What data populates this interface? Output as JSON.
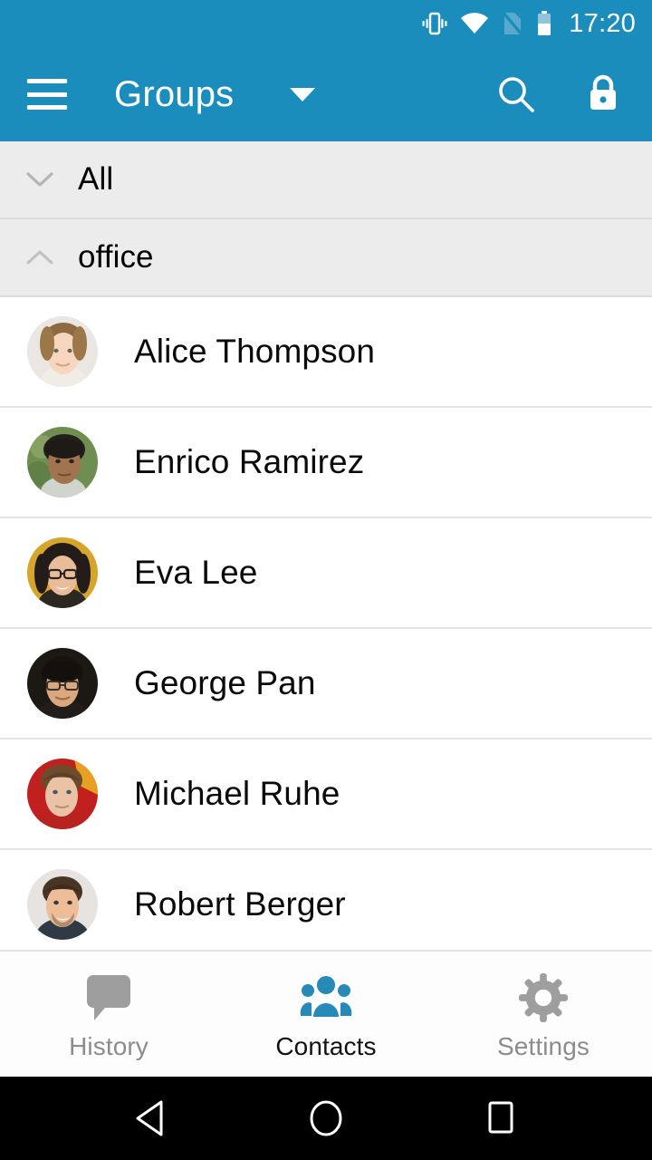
{
  "status_bar": {
    "time": "17:20",
    "icons": [
      {
        "name": "vibrate-icon",
        "label": "vibrate"
      },
      {
        "name": "wifi-icon",
        "label": "wifi"
      },
      {
        "name": "no-sim-icon",
        "label": "no-sim"
      },
      {
        "name": "battery-icon",
        "label": "battery"
      }
    ],
    "background_color": "#1b8dbd",
    "foreground_color": "#ffffff"
  },
  "app_bar": {
    "menu_icon": "hamburger-menu-icon",
    "title": "Groups",
    "dropdown_icon": "chevron-down-icon",
    "actions": [
      {
        "name": "search-icon",
        "label": "Search"
      },
      {
        "name": "lock-icon",
        "label": "Lock"
      }
    ],
    "background_color": "#1b8dbd"
  },
  "groups": [
    {
      "label": "All",
      "expanded": false,
      "chevron": "chevron-down-icon"
    },
    {
      "label": "office",
      "expanded": true,
      "chevron": "chevron-up-icon"
    }
  ],
  "contacts": [
    {
      "name": "Alice Thompson",
      "avatar": {
        "name": "avatar-alice-thompson",
        "bg": "#e6e4e2",
        "skin": "#f3d4be",
        "hair": "#9c7446",
        "cloth": "#f0eae6"
      }
    },
    {
      "name": "Enrico Ramirez",
      "avatar": {
        "name": "avatar-enrico-ramirez",
        "bg": "#6f8f52",
        "skin": "#9e7050",
        "hair": "#23201c",
        "cloth": "#cfd4cc"
      }
    },
    {
      "name": "Eva Lee",
      "avatar": {
        "name": "avatar-eva-lee",
        "bg": "#d6a62c",
        "skin": "#e6b894",
        "hair": "#241c18",
        "cloth": "#2d2722"
      }
    },
    {
      "name": "George Pan",
      "avatar": {
        "name": "avatar-george-pan",
        "bg": "#1c1814",
        "skin": "#d6a47a",
        "hair": "#171310",
        "cloth": "#201b17"
      }
    },
    {
      "name": "Michael Ruhe",
      "avatar": {
        "name": "avatar-michael-ruhe",
        "bg": "#c0201e",
        "skin": "#e8c0a4",
        "hair": "#6d4b2c",
        "cloth": "#b8221f"
      }
    },
    {
      "name": "Robert Berger",
      "avatar": {
        "name": "avatar-robert-berger",
        "bg": "#e3e1de",
        "skin": "#e8bb96",
        "hair": "#4a3525",
        "cloth": "#2f3a46"
      }
    }
  ],
  "tab_bar": {
    "active_color": "#2789b8",
    "inactive_color": "#9a9a9a",
    "items": [
      {
        "label": "History",
        "icon": "speech-bubble-icon",
        "active": false
      },
      {
        "label": "Contacts",
        "icon": "people-group-icon",
        "active": true
      },
      {
        "label": "Settings",
        "icon": "gear-icon",
        "active": false
      }
    ]
  },
  "nav_bar": {
    "buttons": [
      {
        "name": "back-triangle-icon",
        "label": "Back"
      },
      {
        "name": "home-circle-icon",
        "label": "Home"
      },
      {
        "name": "recents-square-icon",
        "label": "Recents"
      }
    ]
  }
}
